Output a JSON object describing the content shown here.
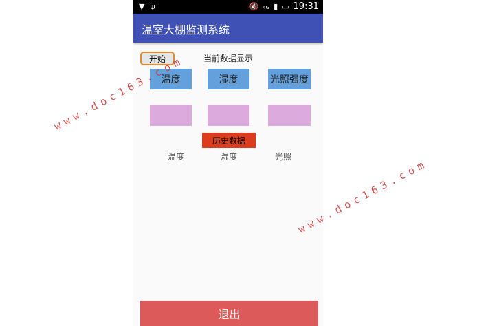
{
  "statusbar": {
    "left_icons": [
      "notification-icon",
      "usb-icon"
    ],
    "network": "4G",
    "time": "19:31"
  },
  "appbar": {
    "title": "温室大棚监测系统"
  },
  "controls": {
    "start_label": "开始",
    "section_label": "当前数据显示",
    "history_label": "历史数据",
    "exit_label": "退出"
  },
  "sensors": [
    {
      "label": "温度",
      "value": ""
    },
    {
      "label": "湿度",
      "value": ""
    },
    {
      "label": "光照强度",
      "value": ""
    }
  ],
  "history_columns": [
    "温度",
    "湿度",
    "光照"
  ],
  "watermarks": [
    "www.doc163.com",
    "www.doc163.com"
  ],
  "colors": {
    "appbar": "#3f51b5",
    "sensor_label_box": "#64a0dc",
    "sensor_value_box": "#dcaadc",
    "history_button": "#dc3c1e",
    "exit_button": "#dc5a5a",
    "start_border": "#e68a2e"
  }
}
